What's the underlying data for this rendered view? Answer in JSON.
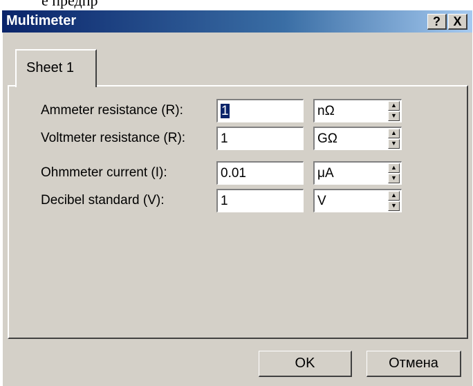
{
  "window": {
    "title": "Multimeter",
    "help_label": "?",
    "close_label": "X"
  },
  "tabs": [
    {
      "label": "Sheet 1",
      "active": true
    }
  ],
  "fields": [
    {
      "label": "Ammeter resistance (R):",
      "value": "1",
      "unit": "nΩ",
      "selected": true
    },
    {
      "label": "Voltmeter resistance (R):",
      "value": "1",
      "unit": "GΩ"
    },
    {
      "label": "Ohmmeter current (I):",
      "value": "0.01",
      "unit": "μA"
    },
    {
      "label": "Decibel standard (V):",
      "value": "1",
      "unit": "V"
    }
  ],
  "spin_icons": {
    "up": "▲",
    "down": "▼"
  },
  "buttons": {
    "ok_label": "OK",
    "cancel_label": "Отмена"
  },
  "colors": {
    "titlebar_start": "#0a246a",
    "titlebar_end": "#a6caf0",
    "dialog_bg": "#d4d0c8",
    "selection": "#0a246a"
  }
}
